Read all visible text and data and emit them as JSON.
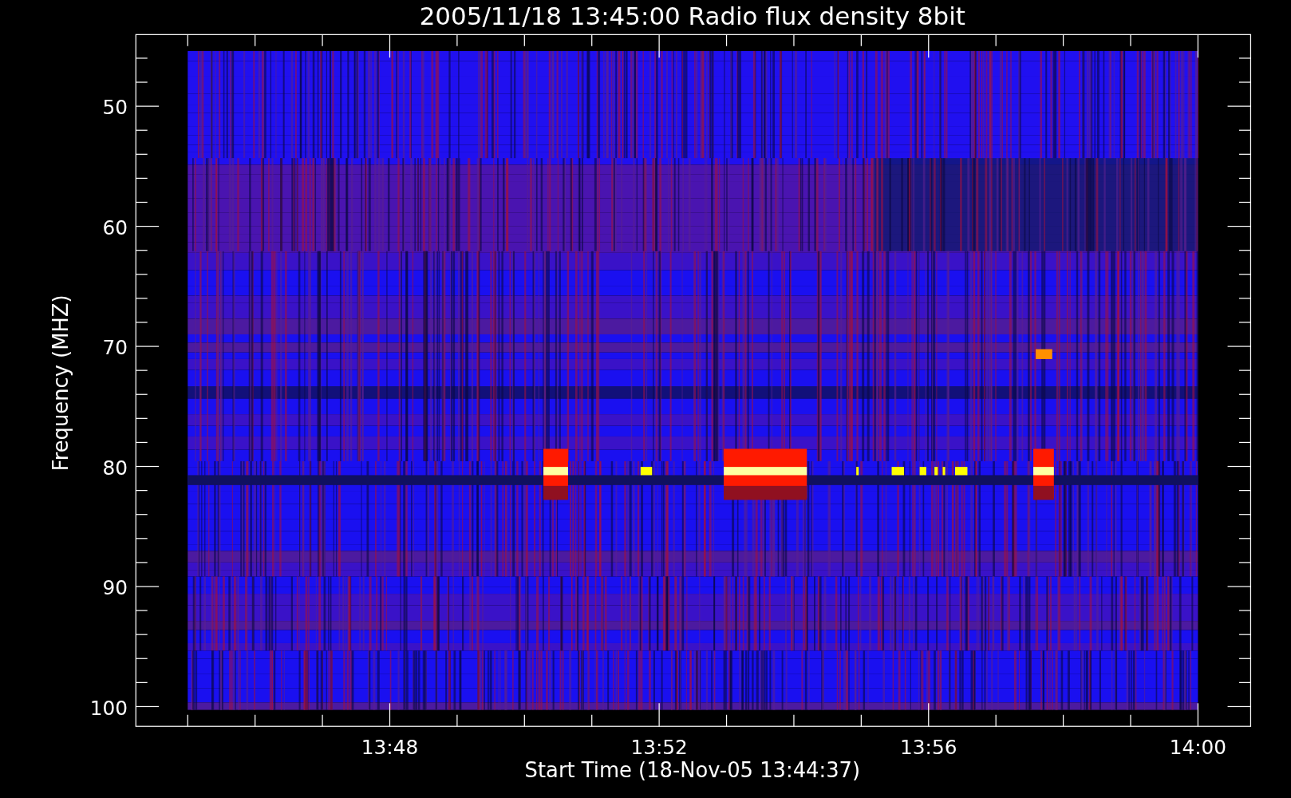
{
  "title": "2005/11/18 13:45:00 Radio flux density 8bit",
  "plot": {
    "ylabel": "Frequency (MHZ)",
    "xlabel": "Start Time (18-Nov-05 13:44:37)",
    "yticks": [
      "50",
      "60",
      "70",
      "80",
      "90",
      "100"
    ],
    "xticks": [
      "13:48",
      "13:52",
      "13:56",
      "14:00"
    ]
  }
}
